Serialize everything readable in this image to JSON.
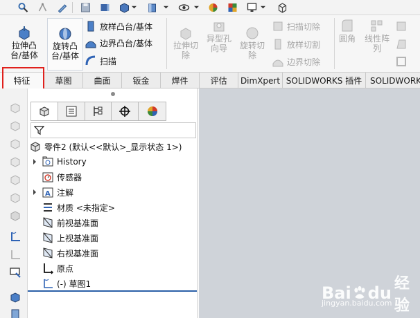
{
  "ribbon": {
    "extrude_boss": "拉伸凸\n台/基体",
    "revolve_boss": "旋转凸\n台/基体",
    "sweep_boss": "放样凸台/基体",
    "boundary_boss": "边界凸台/基体",
    "sweep": "扫描",
    "extrude_cut": "拉伸切\n除",
    "hole_wizard": "异型孔\n向导",
    "revolve_cut": "旋转切\n除",
    "sweep_cut": "扫描切除",
    "loft_cut": "放样切割",
    "boundary_cut": "边界切除",
    "fillet": "圆角",
    "linear_pattern": "线性阵\n列"
  },
  "tabs": [
    {
      "label": "特征"
    },
    {
      "label": "草图"
    },
    {
      "label": "曲面"
    },
    {
      "label": "钣金"
    },
    {
      "label": "焊件"
    },
    {
      "label": "评估"
    },
    {
      "label": "DimXpert"
    },
    {
      "label": "SOLIDWORKS 插件"
    },
    {
      "label": "SOLIDWORKS"
    }
  ],
  "tree": {
    "part": "零件2 (默认<<默认>_显示状态 1>)",
    "history": "History",
    "sensors": "传感器",
    "annotations": "注解",
    "material": "材质 <未指定>",
    "front_plane": "前视基准面",
    "top_plane": "上视基准面",
    "right_plane": "右视基准面",
    "origin": "原点",
    "sketch": "(-) 草图1"
  },
  "watermark": {
    "logo_left": "Bai",
    "logo_right": "du",
    "logo_cn": "经验",
    "url": "jingyan.baidu.com"
  },
  "colors": {
    "highlight": "#e0201c",
    "rollback_bar": "#2b5fa8",
    "graphics_bg": "#cfd3d9"
  }
}
